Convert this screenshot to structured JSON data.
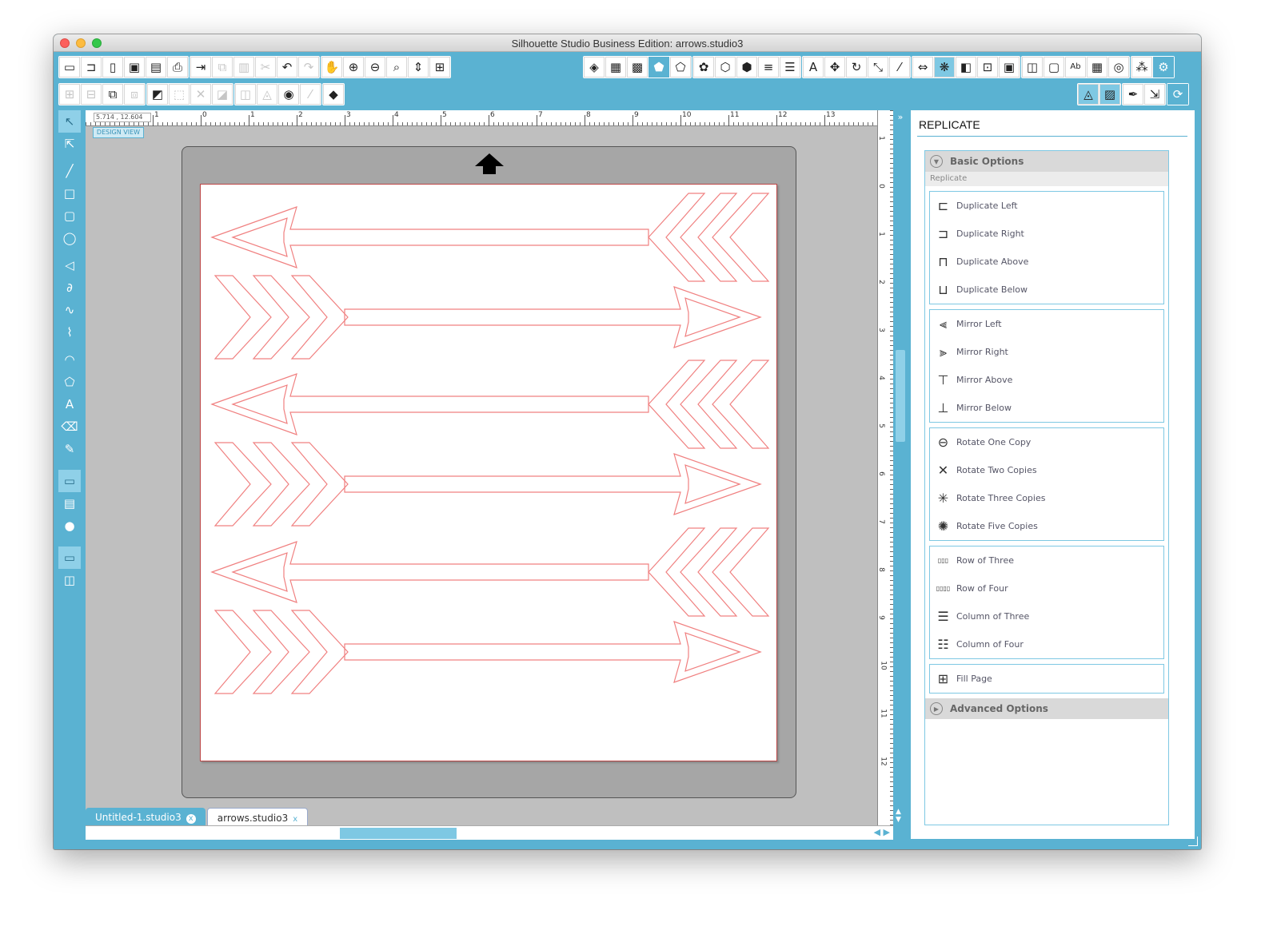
{
  "window": {
    "title": "Silhouette Studio Business Edition: arrows.studio3"
  },
  "toolbar_top": {
    "left": [
      {
        "name": "new-document-icon",
        "glyph": "▭"
      },
      {
        "name": "open-icon",
        "glyph": "⊐"
      },
      {
        "name": "open-library-icon",
        "glyph": "▯"
      },
      {
        "name": "save-icon",
        "glyph": "▣"
      },
      {
        "name": "save-library-icon",
        "glyph": "▤"
      },
      {
        "name": "print-icon",
        "glyph": "⎙"
      },
      {
        "name": "send-icon",
        "glyph": "⇥"
      },
      {
        "name": "copy-icon",
        "glyph": "⧉",
        "dim": true
      },
      {
        "name": "paste-icon",
        "glyph": "▥",
        "dim": true
      },
      {
        "name": "cut-icon",
        "glyph": "✂",
        "dim": true
      },
      {
        "name": "undo-icon",
        "glyph": "↶"
      },
      {
        "name": "redo-icon",
        "glyph": "↷",
        "dim": true
      },
      {
        "name": "pan-icon",
        "glyph": "✋"
      },
      {
        "name": "zoom-in-icon",
        "glyph": "⊕"
      },
      {
        "name": "zoom-out-icon",
        "glyph": "⊖"
      },
      {
        "name": "zoom-selection-icon",
        "glyph": "⌕"
      },
      {
        "name": "zoom-drag-icon",
        "glyph": "⇕"
      },
      {
        "name": "fit-to-window-icon",
        "glyph": "⊞"
      }
    ],
    "right": [
      {
        "name": "fill-color-icon",
        "glyph": "◈"
      },
      {
        "name": "fill-gradient-icon",
        "glyph": "▦"
      },
      {
        "name": "fill-pattern-icon",
        "glyph": "▩"
      },
      {
        "name": "line-color-icon",
        "glyph": "⬟",
        "acc": true
      },
      {
        "name": "line-style-icon",
        "glyph": "⬠"
      },
      {
        "name": "shadow-icon",
        "glyph": "✿"
      },
      {
        "name": "sketch-icon",
        "glyph": "⬡"
      },
      {
        "name": "offset-icon",
        "glyph": "⬢"
      },
      {
        "name": "page-settings-icon",
        "glyph": "≡"
      },
      {
        "name": "align-icon",
        "glyph": "☰"
      },
      {
        "name": "text-style-icon",
        "glyph": "A"
      },
      {
        "name": "transform-icon",
        "glyph": "✥"
      },
      {
        "name": "rotate-icon",
        "glyph": "↻"
      },
      {
        "name": "scale-icon",
        "glyph": "⤡"
      },
      {
        "name": "shear-icon",
        "glyph": "⁄"
      },
      {
        "name": "move-icon",
        "glyph": "⇔"
      },
      {
        "name": "replicate-icon",
        "glyph": "❋",
        "act": true
      },
      {
        "name": "modify-icon",
        "glyph": "◧"
      },
      {
        "name": "trace-icon",
        "glyph": "⊡"
      },
      {
        "name": "print-cut-icon",
        "glyph": "▣"
      },
      {
        "name": "cut-settings-icon",
        "glyph": "◫"
      },
      {
        "name": "page-icon",
        "glyph": "▢"
      },
      {
        "name": "text-to-path-icon",
        "glyph": "Ab"
      },
      {
        "name": "grid-icon",
        "glyph": "▦"
      },
      {
        "name": "registration-icon",
        "glyph": "◎"
      },
      {
        "name": "nesting-icon",
        "glyph": "⁂"
      },
      {
        "name": "settings-gear-icon",
        "glyph": "⚙",
        "acc": true
      }
    ]
  },
  "toolbar_second": {
    "left": [
      {
        "name": "group-icon",
        "glyph": "⊞",
        "dim": true
      },
      {
        "name": "ungroup-icon",
        "glyph": "⊟",
        "dim": true
      },
      {
        "name": "make-compound-icon",
        "glyph": "⧉"
      },
      {
        "name": "release-compound-icon",
        "glyph": "⧈",
        "dim": true
      },
      {
        "name": "bring-front-icon",
        "glyph": "◩"
      },
      {
        "name": "weld-icon",
        "glyph": "⬚",
        "dim": true
      },
      {
        "name": "delete-icon",
        "glyph": "✕",
        "dim": true
      },
      {
        "name": "send-back-icon",
        "glyph": "◪",
        "dim": true
      },
      {
        "name": "bring-forward-icon",
        "glyph": "◫",
        "dim": true
      },
      {
        "name": "send-backward-icon",
        "glyph": "◬",
        "dim": true
      },
      {
        "name": "offset-shape-icon",
        "glyph": "◉"
      },
      {
        "name": "knife-icon",
        "glyph": "⁄",
        "dim": true
      },
      {
        "name": "eraser-icon",
        "glyph": "◆"
      }
    ],
    "right": [
      {
        "name": "cut-style-icon",
        "glyph": "◬",
        "act": true
      },
      {
        "name": "cut-mode-icon",
        "glyph": "▨",
        "act": true
      },
      {
        "name": "pen-tool-icon",
        "glyph": "✒"
      },
      {
        "name": "send-cut-icon",
        "glyph": "⇲"
      },
      {
        "name": "sync-icon",
        "glyph": "⟳",
        "acc": true
      }
    ]
  },
  "left_tools": [
    {
      "name": "select-tool-icon",
      "glyph": "↖",
      "sel": true
    },
    {
      "name": "point-edit-tool-icon",
      "glyph": "⇱"
    },
    {
      "sep": true
    },
    {
      "name": "line-tool-icon",
      "glyph": "╱"
    },
    {
      "name": "rectangle-tool-icon",
      "glyph": "□"
    },
    {
      "name": "rounded-rectangle-tool-icon",
      "glyph": "▢"
    },
    {
      "name": "ellipse-tool-icon",
      "glyph": "◯"
    },
    {
      "sep": true
    },
    {
      "name": "polygon-tool-icon",
      "glyph": "◁"
    },
    {
      "name": "curve-tool-icon",
      "glyph": "∂"
    },
    {
      "name": "freehand-tool-icon",
      "glyph": "∿"
    },
    {
      "name": "smooth-freehand-tool-icon",
      "glyph": "⌇"
    },
    {
      "sep": true
    },
    {
      "name": "arc-tool-icon",
      "glyph": "◠"
    },
    {
      "name": "regular-polygon-tool-icon",
      "glyph": "⬠"
    },
    {
      "name": "text-tool-icon",
      "glyph": "A"
    },
    {
      "name": "eraser-tool-icon",
      "glyph": "⌫"
    },
    {
      "name": "knife-tool-icon",
      "glyph": "✎"
    },
    {
      "sep": true
    },
    {
      "sep": true
    },
    {
      "name": "design-view-icon",
      "glyph": "▭",
      "sel": true
    },
    {
      "name": "library-icon",
      "glyph": "▤"
    },
    {
      "name": "online-store-icon",
      "glyph": "●"
    },
    {
      "sep": true
    },
    {
      "sep": true
    },
    {
      "name": "design-panel-icon",
      "glyph": "▭",
      "sel": true
    },
    {
      "name": "split-view-icon",
      "glyph": "◫"
    }
  ],
  "ruler": {
    "coord_readout": "5.714 , 12.604",
    "h_numbers": [
      "1",
      "0",
      "1",
      "2",
      "3",
      "4",
      "5",
      "6",
      "7",
      "8",
      "9",
      "10",
      "11",
      "12",
      "13"
    ],
    "v_numbers": [
      "1",
      "0",
      "1",
      "2",
      "3",
      "4",
      "5",
      "6",
      "7",
      "8",
      "9",
      "10",
      "11",
      "12"
    ]
  },
  "design_view_label": "DESIGN VIEW",
  "tabs": [
    {
      "label": "Untitled-1.studio3",
      "active": false,
      "close": "x"
    },
    {
      "label": "arrows.studio3",
      "active": true,
      "close": "x"
    }
  ],
  "panel": {
    "title": "REPLICATE",
    "basic_options": "Basic Options",
    "replicate_label": "Replicate",
    "groups": [
      [
        {
          "label": "Duplicate Left",
          "icon": "duplicate-left-icon",
          "glyph": "⊏"
        },
        {
          "label": "Duplicate Right",
          "icon": "duplicate-right-icon",
          "glyph": "⊐"
        },
        {
          "label": "Duplicate Above",
          "icon": "duplicate-above-icon",
          "glyph": "⊓"
        },
        {
          "label": "Duplicate Below",
          "icon": "duplicate-below-icon",
          "glyph": "⊔"
        }
      ],
      [
        {
          "label": "Mirror Left",
          "icon": "mirror-left-icon",
          "glyph": "⫷"
        },
        {
          "label": "Mirror Right",
          "icon": "mirror-right-icon",
          "glyph": "⫸"
        },
        {
          "label": "Mirror Above",
          "icon": "mirror-above-icon",
          "glyph": "⊤"
        },
        {
          "label": "Mirror Below",
          "icon": "mirror-below-icon",
          "glyph": "⊥"
        }
      ],
      [
        {
          "label": "Rotate One Copy",
          "icon": "rotate-one-copy-icon",
          "glyph": "⊖"
        },
        {
          "label": "Rotate Two Copies",
          "icon": "rotate-two-copies-icon",
          "glyph": "✕"
        },
        {
          "label": "Rotate Three Copies",
          "icon": "rotate-three-copies-icon",
          "glyph": "✳"
        },
        {
          "label": "Rotate Five Copies",
          "icon": "rotate-five-copies-icon",
          "glyph": "✺"
        }
      ],
      [
        {
          "label": "Row of Three",
          "icon": "row-of-three-icon",
          "glyph": "▯▯▯"
        },
        {
          "label": "Row of Four",
          "icon": "row-of-four-icon",
          "glyph": "▯▯▯▯"
        },
        {
          "label": "Column of Three",
          "icon": "column-of-three-icon",
          "glyph": "☰"
        },
        {
          "label": "Column of Four",
          "icon": "column-of-four-icon",
          "glyph": "☷"
        }
      ],
      [
        {
          "label": "Fill Page",
          "icon": "fill-page-icon",
          "glyph": "⊞"
        }
      ]
    ],
    "advanced_options": "Advanced Options"
  },
  "colors": {
    "accent": "#5ab2d2",
    "arrow_stroke": "#f08080"
  }
}
